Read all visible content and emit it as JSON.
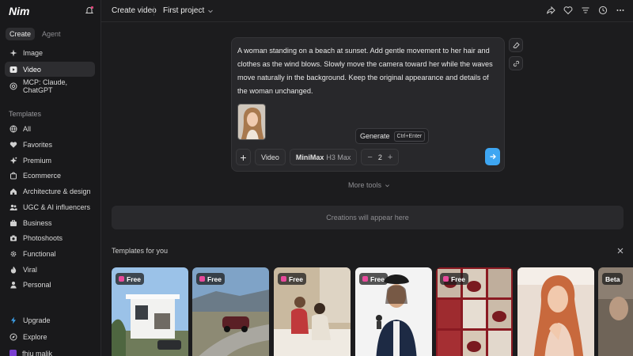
{
  "app": {
    "logo": "Nim"
  },
  "sidebar": {
    "modes": [
      {
        "label": "Create",
        "active": true
      },
      {
        "label": "Agent",
        "active": false
      }
    ],
    "main_items": [
      {
        "label": "Image",
        "icon": "sparkle-icon"
      },
      {
        "label": "Video",
        "icon": "play-icon",
        "selected": true
      },
      {
        "label": "MCP: Claude, ChatGPT",
        "icon": "mcp-icon"
      }
    ],
    "templates_label": "Templates",
    "template_items": [
      {
        "label": "All",
        "icon": "globe-icon"
      },
      {
        "label": "Favorites",
        "icon": "heart-icon"
      },
      {
        "label": "Premium",
        "icon": "premium-icon"
      },
      {
        "label": "Ecommerce",
        "icon": "cart-icon"
      },
      {
        "label": "Architecture & design",
        "icon": "home-icon"
      },
      {
        "label": "UGC & AI influencers",
        "icon": "users-icon"
      },
      {
        "label": "Business",
        "icon": "briefcase-icon"
      },
      {
        "label": "Photoshoots",
        "icon": "camera-icon"
      },
      {
        "label": "Functional",
        "icon": "gear-icon"
      },
      {
        "label": "Viral",
        "icon": "flame-icon"
      },
      {
        "label": "Personal",
        "icon": "person-icon"
      }
    ],
    "bottom_items": [
      {
        "label": "Upgrade",
        "icon": "bolt-icon"
      },
      {
        "label": "Explore",
        "icon": "compass-icon"
      },
      {
        "label": "fhiu malik",
        "icon": "user-badge-icon"
      }
    ]
  },
  "topbar": {
    "title": "Create video",
    "project": "First project"
  },
  "prompt": {
    "text": "A woman standing on a beach at sunset. Add gentle movement to her hair and clothes as the wind blows. Slowly move the camera toward her while the waves move naturally in the background. Keep the original appearance and details of the woman unchanged.",
    "tooltip_label": "Generate",
    "tooltip_shortcut": "Ctrl+Enter",
    "add_label": "+",
    "mode_label": "Video",
    "model_name": "MiniMax",
    "model_variant": "H3 Max",
    "count": "2",
    "minus": "−",
    "plus": "+"
  },
  "more_tools": "More tools",
  "creations_placeholder": "Creations will appear here",
  "templates_section": {
    "title": "Templates for you",
    "badges": [
      "Free",
      "Free",
      "Free",
      "Free",
      "Free",
      "",
      "Beta"
    ]
  },
  "colors": {
    "accent": "#3ea6f2",
    "badge": "#e84a9c",
    "background": "#1c1c1e",
    "sidebar": "#19191b"
  }
}
